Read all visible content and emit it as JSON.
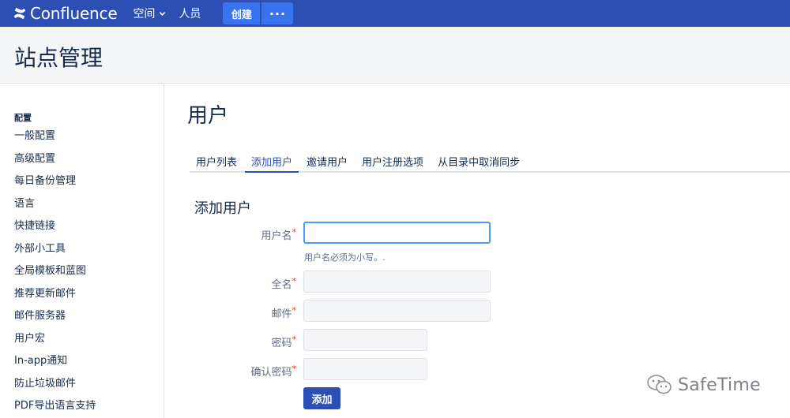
{
  "nav": {
    "logo_text": "Confluence",
    "spaces_label": "空间",
    "people_label": "人员",
    "create_label": "创建",
    "more_label": "···",
    "bar_color": "#2d4fb3"
  },
  "header": {
    "title": "站点管理"
  },
  "sidebar": {
    "heading": "配置",
    "items": [
      {
        "label": "一般配置"
      },
      {
        "label": "高级配置"
      },
      {
        "label": "每日备份管理"
      },
      {
        "label": "语言"
      },
      {
        "label": "快捷链接"
      },
      {
        "label": "外部小工具"
      },
      {
        "label": "全局模板和蓝图"
      },
      {
        "label": "推荐更新邮件"
      },
      {
        "label": "邮件服务器"
      },
      {
        "label": "用户宏"
      },
      {
        "label": "In-app通知"
      },
      {
        "label": "防止垃圾邮件"
      },
      {
        "label": "PDF导出语言支持"
      }
    ]
  },
  "main": {
    "title": "用户",
    "tabs": [
      {
        "label": "用户列表",
        "active": false
      },
      {
        "label": "添加用户",
        "active": true
      },
      {
        "label": "邀请用户",
        "active": false
      },
      {
        "label": "用户注册选项",
        "active": false
      },
      {
        "label": "从目录中取消同步",
        "active": false
      }
    ],
    "section_title": "添加用户"
  },
  "form": {
    "username_label": "用户名",
    "username_value": "",
    "username_hint": "用户名必须为小写。.",
    "fullname_label": "全名",
    "fullname_value": "",
    "email_label": "邮件",
    "email_value": "",
    "password_label": "密码",
    "password_value": "",
    "confirm_label": "确认密码",
    "confirm_value": "",
    "required_mark": "*",
    "submit_label": "添加"
  },
  "watermark": {
    "text": "SafeTime"
  }
}
